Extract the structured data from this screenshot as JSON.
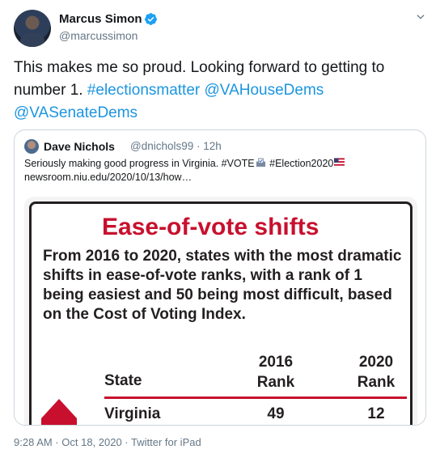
{
  "author": {
    "name": "Marcus Simon",
    "handle": "@marcussimon"
  },
  "tweet": {
    "text_plain": "This makes me so proud. Looking forward to getting to number 1. ",
    "hashtag_1": "#electionsmatter",
    "mention_1": "@VAHouseDems",
    "mention_2": "@VASenateDems"
  },
  "quoted": {
    "name": "Dave Nichols",
    "handle_time": "@dnichols99 · 12h",
    "text": "Seriously making good progress in Virginia. #VOTE",
    "hashtag_2": "#Election2020",
    "url": "newsroom.niu.edu/2020/10/13/how…",
    "image": {
      "title": "Ease-of-vote shifts",
      "description": "From 2016 to 2020, states with the most dramatic shifts in ease-of-vote ranks, with a rank of 1 being easiest and 50 being most difficult, based on the Cost of Voting Index.",
      "col_state": "State",
      "col_2016_year": "2016",
      "col_2016_rank": "Rank",
      "col_2020_year": "2020",
      "col_2020_rank": "Rank",
      "row": {
        "state": "Virginia",
        "rank_2016": "49",
        "rank_2020": "12"
      },
      "accent": "#c8102e"
    }
  },
  "meta": {
    "timestamp": "9:28 AM · Oct 18, 2020 · Twitter for iPad"
  },
  "colors": {
    "link": "#1b95e0",
    "muted": "#657786",
    "verified": "#1da1f2"
  }
}
